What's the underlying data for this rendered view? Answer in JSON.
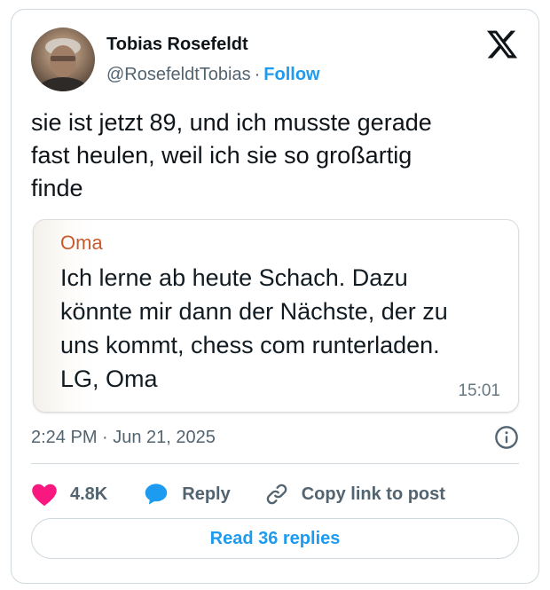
{
  "author": {
    "name": "Tobias Rosefeldt",
    "handle": "@RosefeldtTobias",
    "separator": "·",
    "follow_label": "Follow"
  },
  "tweet": {
    "lines": [
      "sie ist jetzt 89, und ich musste gerade",
      "fast heulen, weil ich sie so großartig",
      "finde"
    ]
  },
  "quoted_message": {
    "sender": "Oma",
    "lines": [
      "Ich lerne ab heute Schach. Dazu",
      "könnte mir dann der Nächste, der zu",
      "uns kommt, chess com runterladen.",
      "LG, Oma"
    ],
    "time": "15:01"
  },
  "meta": {
    "timestamp": "2:24 PM · Jun 21, 2025"
  },
  "actions": {
    "like_count": "4.8K",
    "reply_label": "Reply",
    "copy_label": "Copy link to post"
  },
  "read_replies_label": "Read 36 replies",
  "icons": {
    "platform": "x-logo-icon",
    "like": "heart-icon",
    "reply": "speech-bubble-icon",
    "copy": "link-icon",
    "info": "info-icon"
  },
  "colors": {
    "accent": "#1d9bf0",
    "like": "#f91880",
    "sender_name": "#c95a2e",
    "secondary_text": "#536471"
  }
}
